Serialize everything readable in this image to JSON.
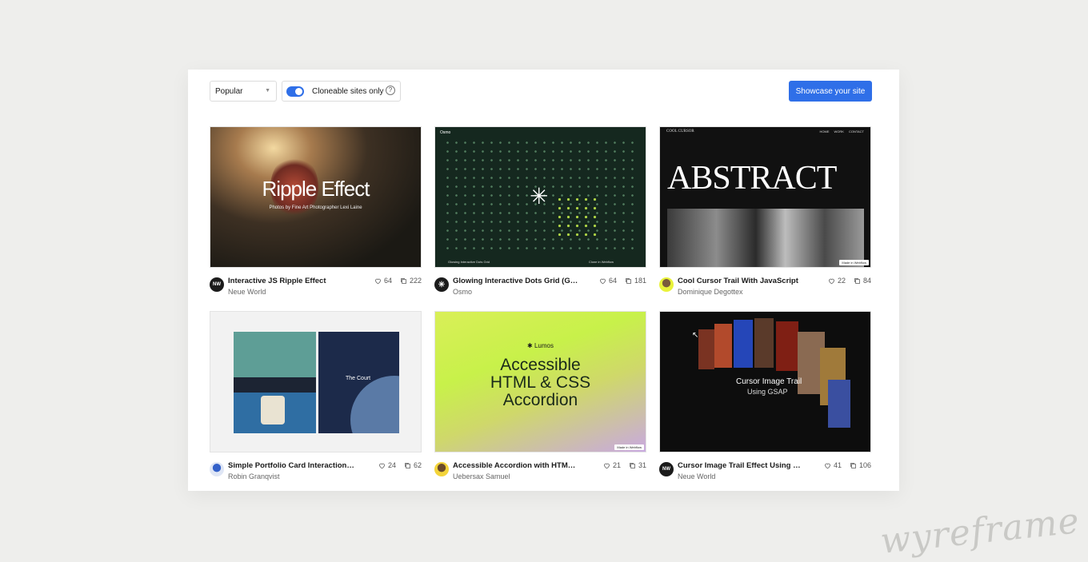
{
  "toolbar": {
    "sort_value": "Popular",
    "toggle_label": "Cloneable sites only",
    "toggle_on": true,
    "help_glyph": "?",
    "showcase_label": "Showcase your site"
  },
  "cards": [
    {
      "title": "Interactive JS Ripple Effect",
      "author": "Neue World",
      "likes": "64",
      "clones": "222",
      "thumb_heading": "Ripple Effect",
      "thumb_sub": "Photos by Fine Art Photographer Lexi Laine",
      "avatar": "NW"
    },
    {
      "title": "Glowing Interactive Dots Grid (GSAP ...",
      "author": "Osmo",
      "likes": "64",
      "clones": "181",
      "thumb_corner": "Osmo",
      "thumb_footer_left": "Glowing Interactive Dots Grid",
      "thumb_footer_right": "Clone in Webflow",
      "avatar": "✳"
    },
    {
      "title": "Cool Cursor Trail With JavaScript",
      "author": "Dominique Degottex",
      "likes": "22",
      "clones": "84",
      "thumb_heading": "ABSTRACT",
      "thumb_corner": "COOL CURSOR",
      "thumb_nav": [
        "HOME",
        "WORK",
        "CONTACT"
      ],
      "thumb_badge": "Made in Webflow",
      "avatar": ""
    },
    {
      "title": "Simple Portfolio Card Interaction Co...",
      "author": "Robin Granqvist",
      "likes": "24",
      "clones": "62",
      "thumb_heading": "The Court",
      "avatar": ""
    },
    {
      "title": "Accessible Accordion with HTML <det...",
      "author": "Uebersax Samuel",
      "likes": "21",
      "clones": "31",
      "thumb_brand": "✱ Lumos",
      "thumb_heading": "Accessible HTML & CSS Accordion",
      "thumb_badge": "Made in Webflow",
      "avatar": ""
    },
    {
      "title": "Cursor Image Trail Effect Using GSAP",
      "author": "Neue World",
      "likes": "41",
      "clones": "106",
      "thumb_heading": "Cursor Image Trail",
      "thumb_sub": "Using GSAP",
      "avatar": "NW"
    }
  ],
  "watermark": "wyreframe",
  "colors": {
    "accent": "#2f6fe8",
    "osmo_green": "#15281f",
    "lumos_lime": "#c8f14a"
  }
}
